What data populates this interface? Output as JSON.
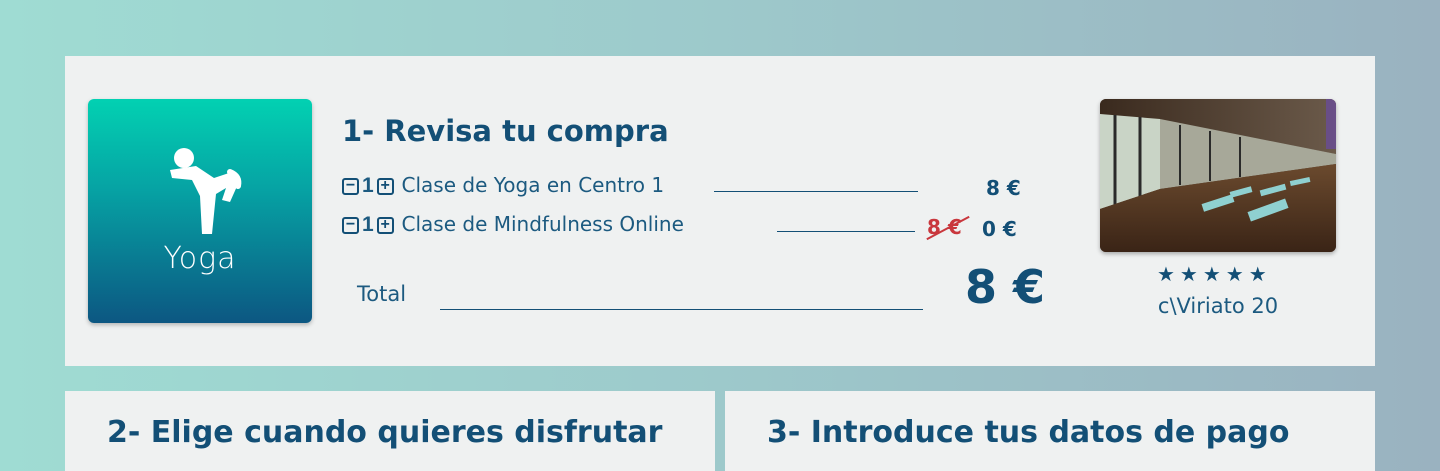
{
  "step1": {
    "title": "1- Revisa tu compra",
    "category_tile": {
      "label": "Yoga",
      "icon": "yoga-pose-icon"
    },
    "items": [
      {
        "qty": "1",
        "name": "Clase de Yoga en Centro 1",
        "price": "8 €"
      },
      {
        "qty": "1",
        "name": "Clase de Mindfulness Online",
        "old_price": "8 €",
        "price": "0 €"
      }
    ],
    "stepper": {
      "minus": "−",
      "plus": "+"
    },
    "total_label": "Total",
    "total_value": "8 €",
    "venue": {
      "photo": "studio-photo",
      "rating": "★★★★★",
      "rating_value": 5,
      "address": "c\\Viriato 20"
    }
  },
  "step2": {
    "title": "2- Elige cuando quieres disfrutar"
  },
  "step3": {
    "title": "3- Introduce tus datos de pago"
  },
  "colors": {
    "primary": "#134f76",
    "discount": "#c9373d",
    "card_bg": "#eff1f1"
  }
}
